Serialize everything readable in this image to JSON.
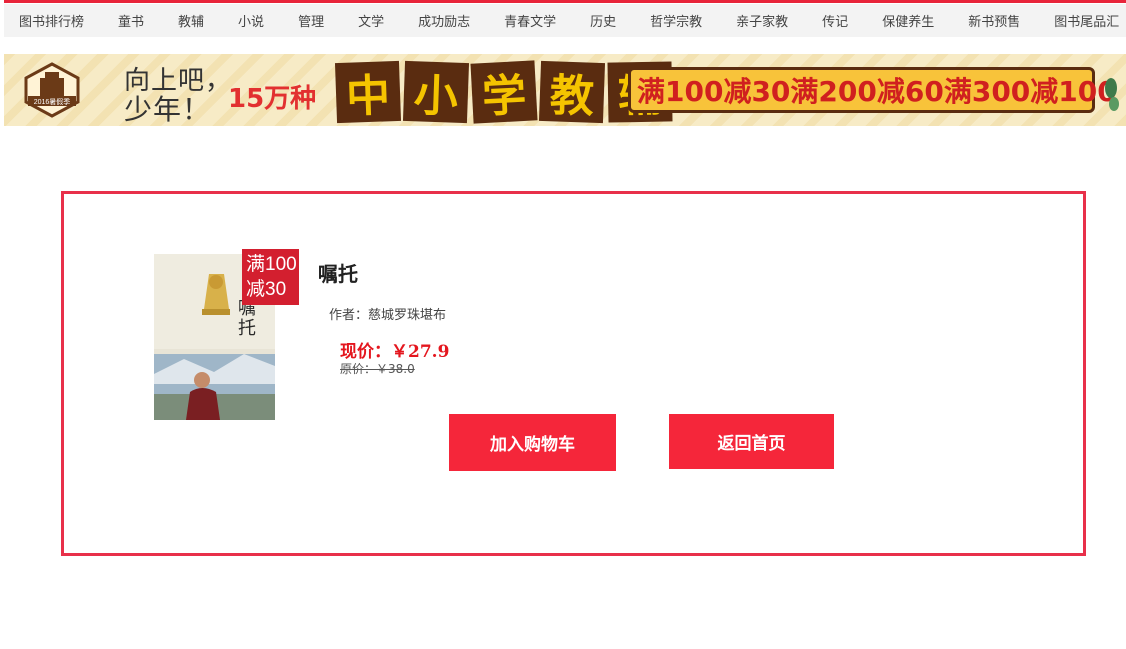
{
  "nav": {
    "items": [
      "图书排行榜",
      "童书",
      "教辅",
      "小说",
      "管理",
      "文学",
      "成功励志",
      "青春文学",
      "历史",
      "哲学宗教",
      "亲子家教",
      "传记",
      "保健养生",
      "新书预售",
      "图书尾品汇"
    ]
  },
  "banner": {
    "badge_text": "2016暑假季",
    "slogan_line1": "向上吧，",
    "slogan_line2": "少年！",
    "count": "15万种",
    "tiles": [
      "中",
      "小",
      "学",
      "教",
      "辅"
    ],
    "promos": [
      "满100减30",
      "满200减60",
      "满300减100"
    ]
  },
  "product": {
    "title": "嘱托",
    "author_label": "作者：",
    "author": "慈城罗珠堪布",
    "price_label": "现价：",
    "price": "￥27.9",
    "original_label": "原价：",
    "original_price": "￥38.0",
    "promo_tag_line1": "满100",
    "promo_tag_line2": "减30"
  },
  "buttons": {
    "add_to_cart": "加入购物车",
    "back_home": "返回首页"
  },
  "colors": {
    "accent": "#e8243a",
    "price": "#e4161e",
    "button": "#f5263a"
  }
}
